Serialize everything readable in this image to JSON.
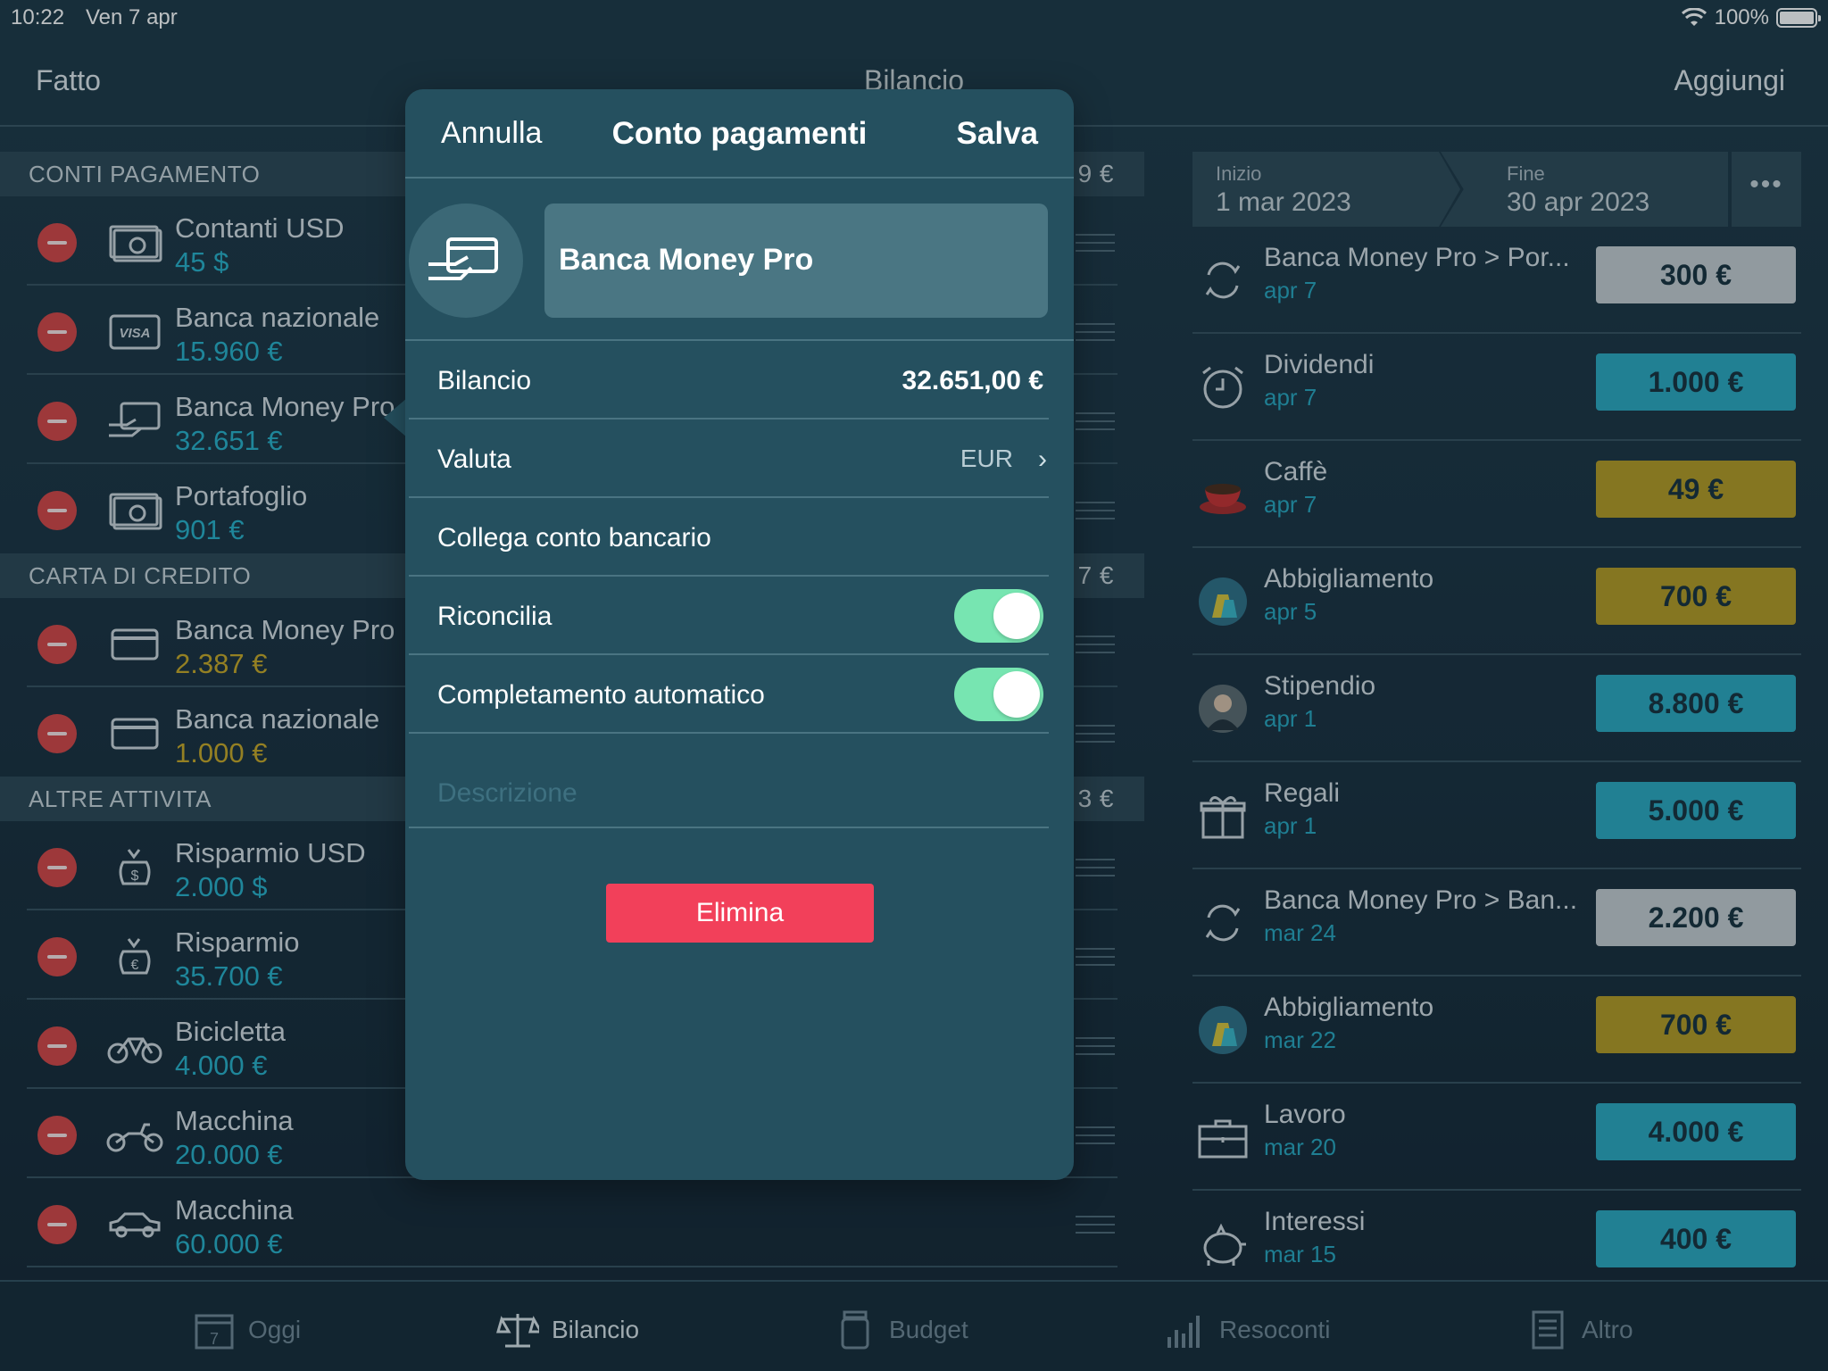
{
  "status": {
    "time": "10:22",
    "date": "Ven 7 apr",
    "battery": "100%"
  },
  "nav": {
    "left": "Fatto",
    "title": "Bilancio",
    "right": "Aggiungi"
  },
  "sections": [
    {
      "header": "CONTI PAGAMENTO",
      "total_tail": "9 €",
      "items": [
        {
          "name": "Contanti USD",
          "amount": "45 $",
          "icon": "cash-icon",
          "color": "blue"
        },
        {
          "name": "Banca nazionale",
          "amount": "15.960 €",
          "icon": "visa-card-icon",
          "color": "blue"
        },
        {
          "name": "Banca Money Pro",
          "amount": "32.651 €",
          "icon": "hand-card-icon",
          "color": "blue"
        },
        {
          "name": "Portafoglio",
          "amount": "901 €",
          "icon": "cash-icon",
          "color": "blue"
        }
      ]
    },
    {
      "header": "CARTA DI CREDITO",
      "total_tail": "7 €",
      "items": [
        {
          "name": "Banca Money Pro",
          "amount": "2.387 €",
          "icon": "credit-card-icon",
          "color": "gold"
        },
        {
          "name": "Banca nazionale",
          "amount": "1.000 €",
          "icon": "credit-card-icon",
          "color": "gold"
        }
      ]
    },
    {
      "header": "ALTRE ATTIVITA",
      "total_tail": "3 €",
      "items": [
        {
          "name": "Risparmio USD",
          "amount": "2.000 $",
          "icon": "money-bag-dollar-icon",
          "color": "blue"
        },
        {
          "name": "Risparmio",
          "amount": "35.700 €",
          "icon": "money-bag-euro-icon",
          "color": "blue"
        },
        {
          "name": "Bicicletta",
          "amount": "4.000 €",
          "icon": "bicycle-icon",
          "color": "blue"
        },
        {
          "name": "Macchina",
          "amount": "20.000 €",
          "icon": "motorcycle-icon",
          "color": "blue"
        },
        {
          "name": "Macchina",
          "amount": "60.000 €",
          "icon": "car-icon",
          "color": "blue"
        }
      ]
    }
  ],
  "range": {
    "start_label": "Inizio",
    "start": "1 mar 2023",
    "end_label": "Fine",
    "end": "30 apr 2023",
    "more": "•••"
  },
  "transactions": [
    {
      "name": "Banca Money Pro > Por...",
      "date": "apr 7",
      "amount": "300 €",
      "color": "#c5ccd0",
      "icon": "transfer-icon"
    },
    {
      "name": "Dividendi",
      "date": "apr 7",
      "amount": "1.000 €",
      "color": "#2aa8c0",
      "icon": "alarm-clock-icon"
    },
    {
      "name": "Caffè",
      "date": "apr 7",
      "amount": "49 €",
      "color": "#b49a22",
      "icon": "coffee-cup-icon"
    },
    {
      "name": "Abbigliamento",
      "date": "apr 5",
      "amount": "700 €",
      "color": "#b49a22",
      "icon": "shopping-bags-icon"
    },
    {
      "name": "Stipendio",
      "date": "apr 1",
      "amount": "8.800 €",
      "color": "#2aa8c0",
      "icon": "person-avatar-icon"
    },
    {
      "name": "Regali",
      "date": "apr 1",
      "amount": "5.000 €",
      "color": "#2aa8c0",
      "icon": "gift-icon"
    },
    {
      "name": "Banca Money Pro > Ban...",
      "date": "mar 24",
      "amount": "2.200 €",
      "color": "#c5ccd0",
      "icon": "transfer-icon"
    },
    {
      "name": "Abbigliamento",
      "date": "mar 22",
      "amount": "700 €",
      "color": "#b49a22",
      "icon": "shopping-bags-icon"
    },
    {
      "name": "Lavoro",
      "date": "mar 20",
      "amount": "4.000 €",
      "color": "#2aa8c0",
      "icon": "briefcase-icon"
    },
    {
      "name": "Interessi",
      "date": "mar 15",
      "amount": "400 €",
      "color": "#2aa8c0",
      "icon": "piggy-bank-icon"
    }
  ],
  "modal": {
    "cancel": "Annulla",
    "title": "Conto pagamenti",
    "save": "Salva",
    "account_name": "Banca Money Pro",
    "balance_label": "Bilancio",
    "balance_value": "32.651,00 €",
    "currency_label": "Valuta",
    "currency_value": "EUR",
    "link_label": "Collega conto bancario",
    "reconcile_label": "Riconcilia",
    "reconcile_on": true,
    "autocomplete_label": "Completamento automatico",
    "autocomplete_on": true,
    "description_placeholder": "Descrizione",
    "delete": "Elimina"
  },
  "tabs": [
    {
      "label": "Oggi",
      "icon": "calendar-icon",
      "active": false
    },
    {
      "label": "Bilancio",
      "icon": "scales-icon",
      "active": true
    },
    {
      "label": "Budget",
      "icon": "jar-icon",
      "active": false
    },
    {
      "label": "Resoconti",
      "icon": "bar-chart-icon",
      "active": false
    },
    {
      "label": "Altro",
      "icon": "document-icon",
      "active": false
    }
  ]
}
